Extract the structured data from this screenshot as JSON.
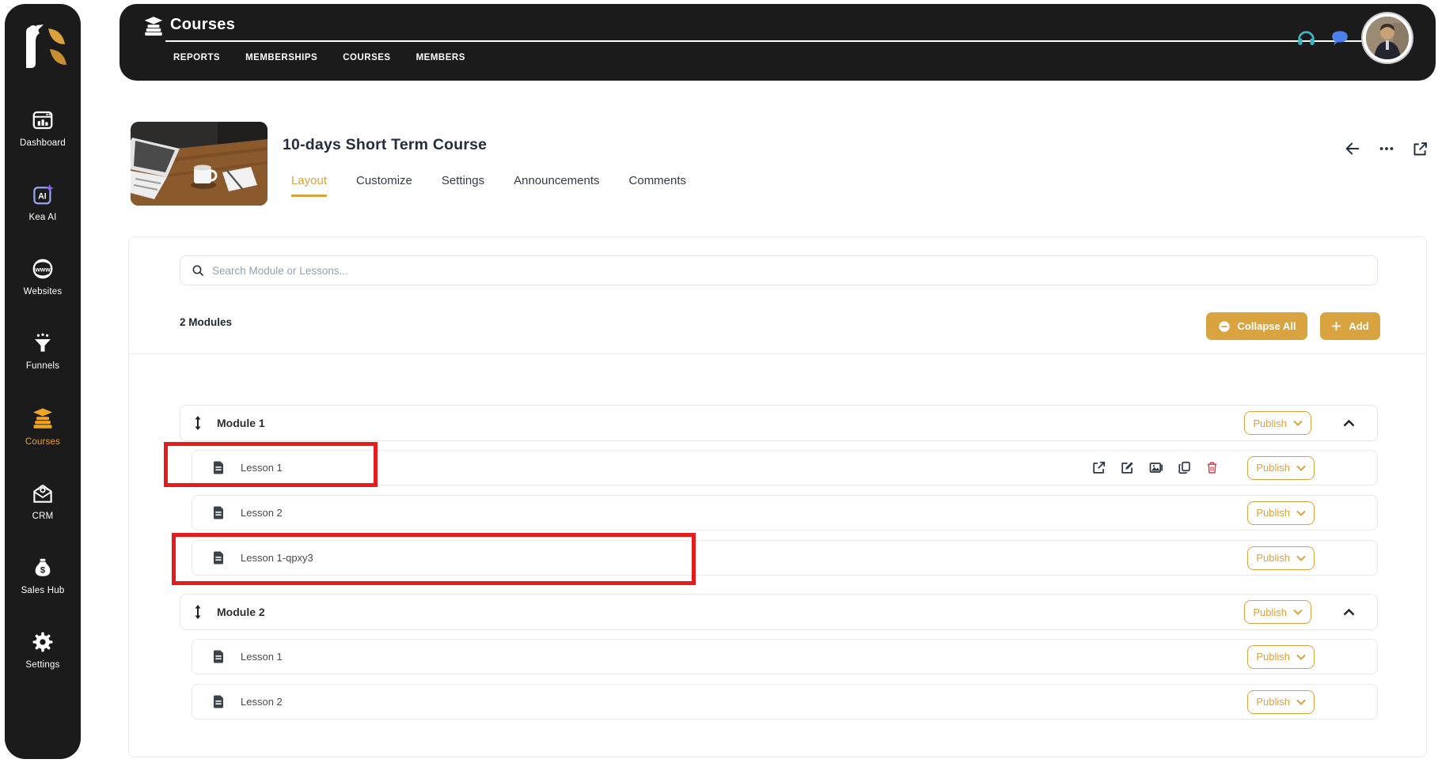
{
  "sidebar": {
    "items": [
      {
        "label": "Dashboard",
        "active": false
      },
      {
        "label": "Kea AI",
        "active": false
      },
      {
        "label": "Websites",
        "active": false
      },
      {
        "label": "Funnels",
        "active": false
      },
      {
        "label": "Courses",
        "active": true
      },
      {
        "label": "CRM",
        "active": false
      },
      {
        "label": "Sales Hub",
        "active": false
      },
      {
        "label": "Settings",
        "active": false
      }
    ]
  },
  "header": {
    "title": "Courses",
    "nav": [
      {
        "label": "REPORTS"
      },
      {
        "label": "MEMBERSHIPS"
      },
      {
        "label": "COURSES"
      },
      {
        "label": "MEMBERS"
      }
    ]
  },
  "course": {
    "title": "10-days Short Term Course",
    "tabs": [
      {
        "label": "Layout",
        "active": true
      },
      {
        "label": "Customize",
        "active": false
      },
      {
        "label": "Settings",
        "active": false
      },
      {
        "label": "Announcements",
        "active": false
      },
      {
        "label": "Comments",
        "active": false
      }
    ],
    "search_placeholder": "Search Module or Lessons...",
    "modules_count": "2 Modules",
    "collapse_all": "Collapse All",
    "add": "Add",
    "publish": "Publish",
    "modules": [
      {
        "name": "Module 1",
        "lessons": [
          {
            "name": "Lesson 1",
            "highlighted": true,
            "hover_actions": true
          },
          {
            "name": "Lesson 2",
            "highlighted": false
          },
          {
            "name": "Lesson 1-qpxy3",
            "highlighted": true
          }
        ]
      },
      {
        "name": "Module 2",
        "lessons": [
          {
            "name": "Lesson 1",
            "highlighted": false
          },
          {
            "name": "Lesson 2",
            "highlighted": false
          }
        ]
      }
    ]
  },
  "colors": {
    "accent_gold": "#d9a440",
    "sidebar_bg": "#1b1b1b",
    "highlight_red": "#e41c1c",
    "danger_red": "#dc4050",
    "headset_teal": "#3fb2c4",
    "chat_blue": "#4c7fe8",
    "text_dark": "#222e3e"
  }
}
